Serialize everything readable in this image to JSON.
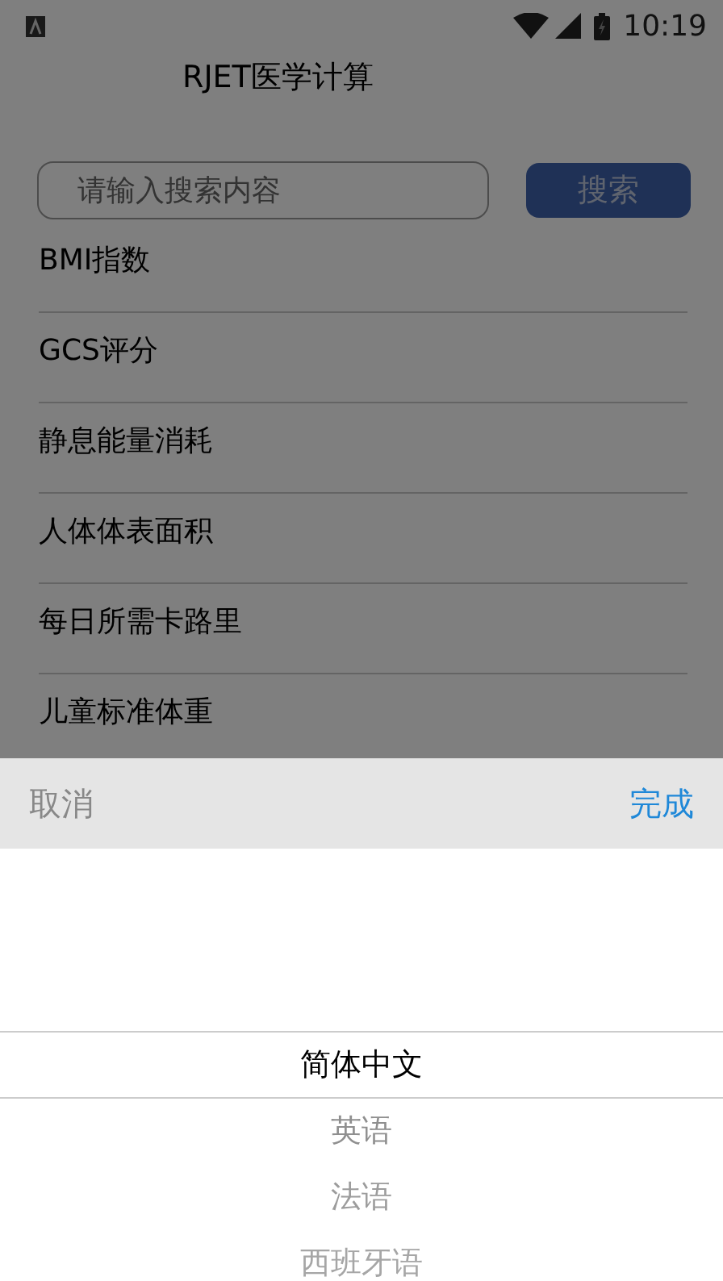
{
  "status_bar": {
    "time": "10:19"
  },
  "app_bar": {
    "title": "RJET医学计算"
  },
  "search": {
    "placeholder": "请输入搜索内容",
    "button": "搜索"
  },
  "items": [
    {
      "label": "BMI指数"
    },
    {
      "label": "GCS评分"
    },
    {
      "label": "静息能量消耗"
    },
    {
      "label": "人体体表面积"
    },
    {
      "label": "每日所需卡路里"
    },
    {
      "label": "儿童标准体重"
    }
  ],
  "picker": {
    "cancel": "取消",
    "done": "完成",
    "options": [
      {
        "label": "简体中文",
        "selected": true
      },
      {
        "label": "英语",
        "selected": false
      },
      {
        "label": "法语",
        "selected": false
      },
      {
        "label": "西班牙语",
        "selected": false
      }
    ]
  }
}
